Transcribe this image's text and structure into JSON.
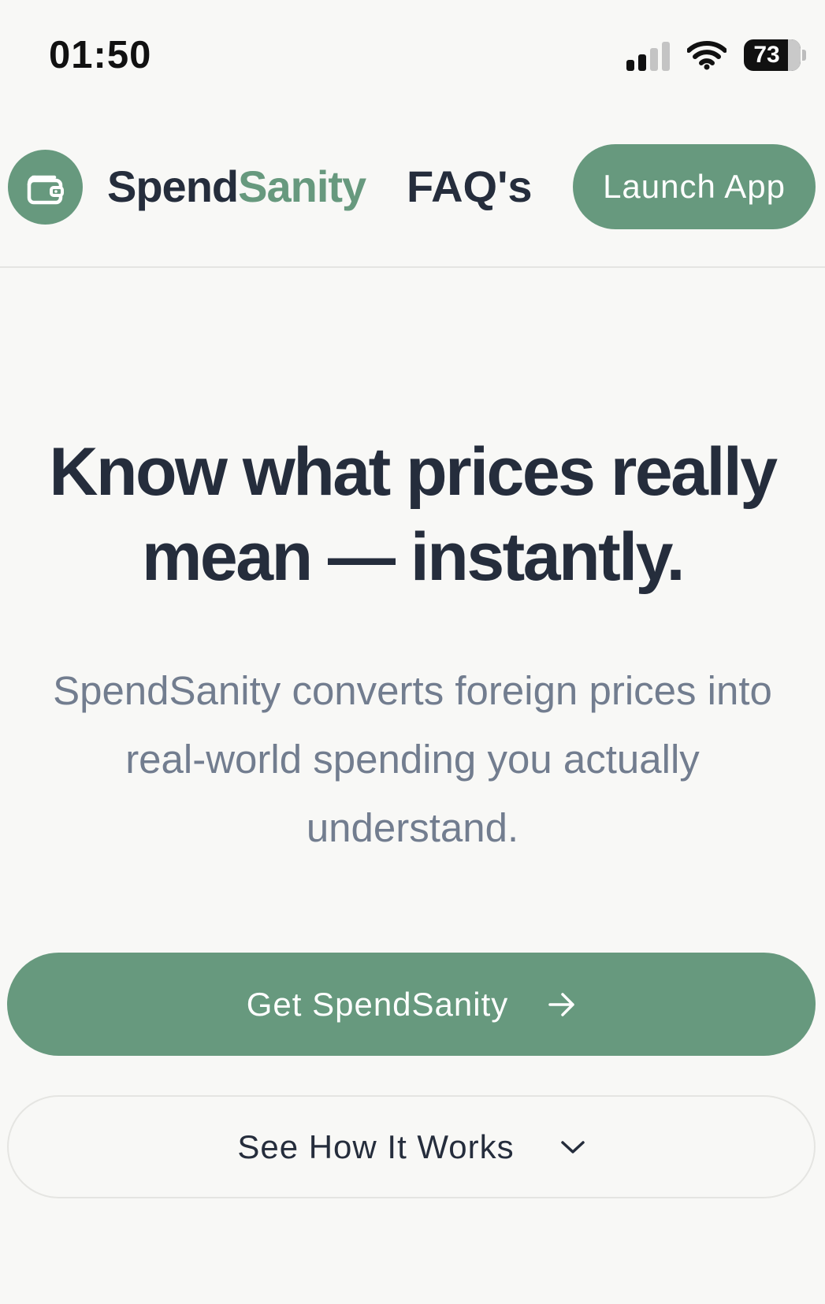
{
  "status_bar": {
    "time": "01:50",
    "battery": "73",
    "icons": [
      "cellular-signal-icon",
      "wifi-icon",
      "battery-icon"
    ]
  },
  "nav": {
    "logo_icon": "wallet-icon",
    "brand_part1": "Spend",
    "brand_part2": "Sanity",
    "faq_label": "FAQ's",
    "launch_label": "Launch App"
  },
  "hero": {
    "title_line1": "Know what prices really",
    "title_line2": "mean — instantly.",
    "subtitle_line1": "SpendSanity converts foreign prices into",
    "subtitle_line2": "real-world spending you actually",
    "subtitle_line3": "understand."
  },
  "actions": {
    "primary_label": "Get SpendSanity",
    "primary_icon": "arrow-right-icon",
    "secondary_label": "See How It Works",
    "secondary_icon": "chevron-down-icon"
  },
  "colors": {
    "accent": "#67997e",
    "text_dark": "#252d3c",
    "text_muted": "#727d8f",
    "background": "#f8f8f6"
  }
}
